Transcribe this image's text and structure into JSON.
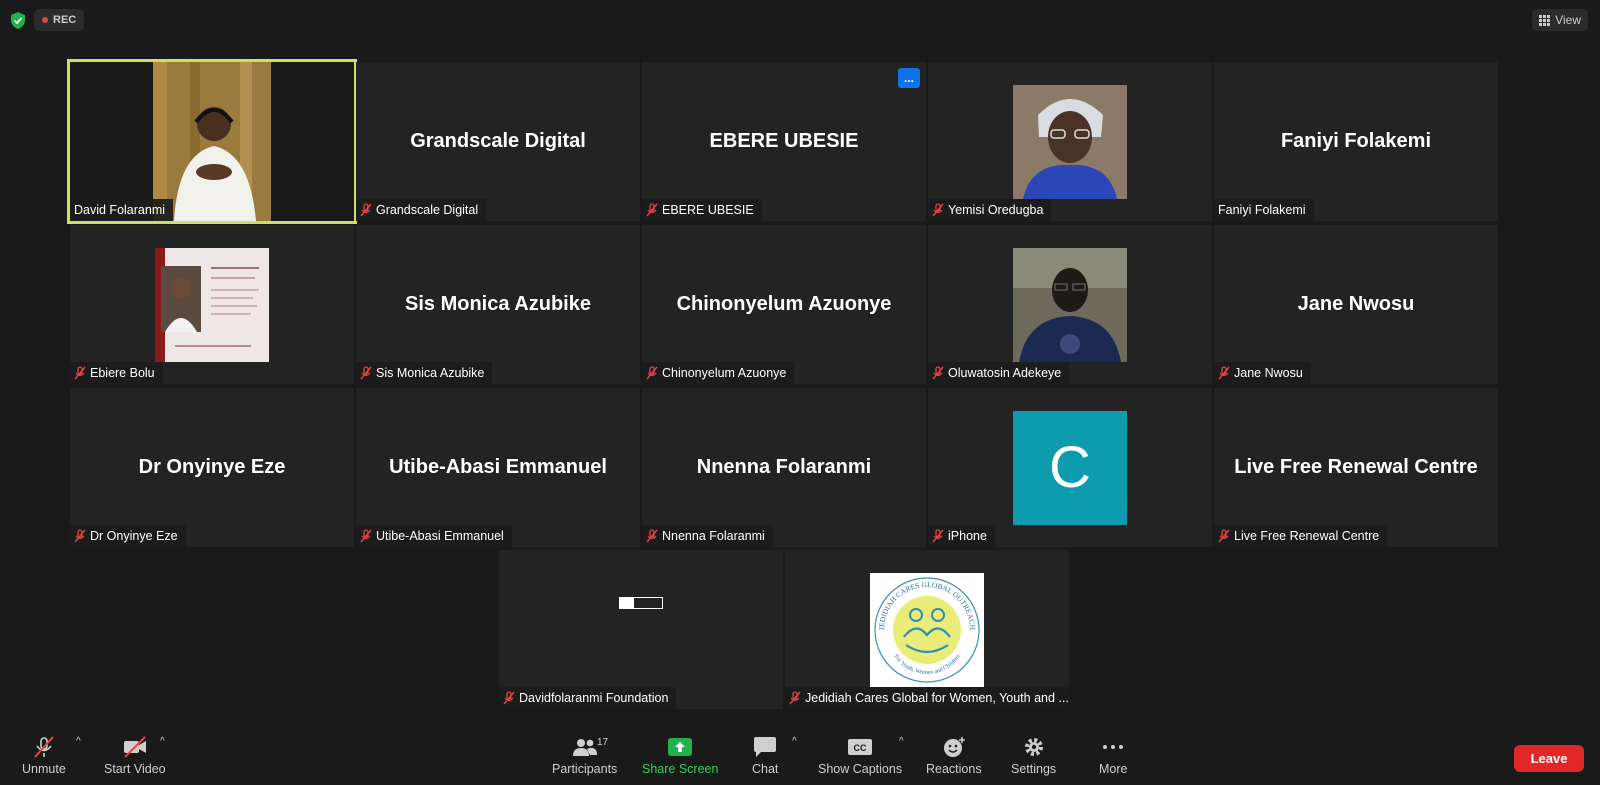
{
  "top": {
    "rec_label": "REC",
    "view_label": "View"
  },
  "tiles": [
    {
      "display": "",
      "label": "David Folaranmi",
      "muted": false,
      "active": true,
      "kind": "video"
    },
    {
      "display": "Grandscale Digital",
      "label": "Grandscale Digital",
      "muted": true,
      "kind": "name"
    },
    {
      "display": "EBERE UBESIE",
      "label": "EBERE UBESIE",
      "muted": true,
      "kind": "name",
      "overlay_button": "..."
    },
    {
      "display": "",
      "label": "Yemisi Oredugba",
      "muted": true,
      "kind": "photo"
    },
    {
      "display": "Faniyi Folakemi",
      "label": "Faniyi Folakemi",
      "muted": false,
      "kind": "name"
    },
    {
      "display": "",
      "label": "Ebiere Bolu",
      "muted": true,
      "kind": "flyer"
    },
    {
      "display": "Sis Monica Azubike",
      "label": "Sis Monica Azubike",
      "muted": true,
      "kind": "name"
    },
    {
      "display": "Chinonyelum Azuonye",
      "label": "Chinonyelum Azuonye",
      "muted": true,
      "kind": "name"
    },
    {
      "display": "",
      "label": "Oluwatosin Adekeye",
      "muted": true,
      "kind": "photo"
    },
    {
      "display": "Jane Nwosu",
      "label": "Jane Nwosu",
      "muted": true,
      "kind": "name"
    },
    {
      "display": "Dr Onyinye Eze",
      "label": "Dr Onyinye Eze",
      "muted": true,
      "kind": "name"
    },
    {
      "display": "Utibe-Abasi Emmanuel",
      "label": "Utibe-Abasi Emmanuel",
      "muted": true,
      "kind": "name"
    },
    {
      "display": "Nnenna Folaranmi",
      "label": "Nnenna Folaranmi",
      "muted": true,
      "kind": "name"
    },
    {
      "display": "C",
      "label": "iPhone",
      "muted": true,
      "kind": "avatar"
    },
    {
      "display": "Live Free Renewal Centre",
      "label": "Live Free Renewal Centre",
      "muted": true,
      "kind": "name"
    },
    {
      "display": "",
      "label": "Davidfolaranmi Foundation",
      "muted": true,
      "kind": "blank"
    },
    {
      "display": "JEDIDIAH CARES GLOBAL OUTREACH",
      "label": "Jedidiah Cares Global for Women, Youth and ...",
      "muted": true,
      "kind": "logo",
      "logo_sub": "For Youth, Women and Children"
    }
  ],
  "toolbar": {
    "unmute": "Unmute",
    "start_video": "Start Video",
    "participants": "Participants",
    "participant_count": "17",
    "share_screen": "Share Screen",
    "chat": "Chat",
    "show_captions": "Show Captions",
    "reactions": "Reactions",
    "settings": "Settings",
    "more": "More",
    "leave": "Leave"
  },
  "colors": {
    "active_border": "#c9e265",
    "leave_red": "#e02828",
    "share_green": "#2ed15e",
    "avatar_teal": "#0d9cae",
    "mute_red": "#e34545"
  }
}
